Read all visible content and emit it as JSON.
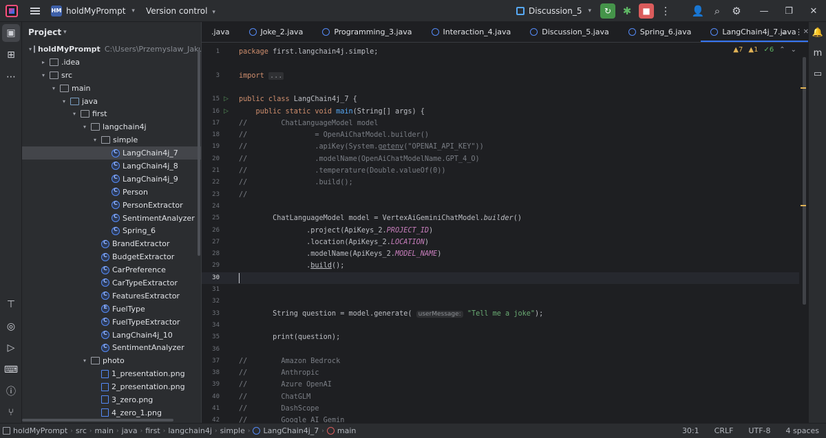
{
  "titlebar": {
    "project_badge": "HM",
    "project_name": "holdMyPrompt",
    "vcs_label": "Version control",
    "run_config": "Discussion_5"
  },
  "project_panel": {
    "title": "Project",
    "tree": [
      {
        "label": "holdMyPrompt",
        "hint": "C:\\Users\\Przemyslaw_Jakub",
        "depth": 0,
        "arrow": "down",
        "icon": "mod",
        "bold": true
      },
      {
        "label": ".idea",
        "depth": 1,
        "arrow": "right",
        "icon": "folder"
      },
      {
        "label": "src",
        "depth": 1,
        "arrow": "down",
        "icon": "folder"
      },
      {
        "label": "main",
        "depth": 2,
        "arrow": "down",
        "icon": "folder"
      },
      {
        "label": "java",
        "depth": 3,
        "arrow": "down",
        "icon": "folder src"
      },
      {
        "label": "first",
        "depth": 4,
        "arrow": "down",
        "icon": "folder"
      },
      {
        "label": "langchain4j",
        "depth": 5,
        "arrow": "down",
        "icon": "folder"
      },
      {
        "label": "simple",
        "depth": 6,
        "arrow": "down",
        "icon": "folder"
      },
      {
        "label": "LangChain4j_7",
        "depth": 7,
        "arrow": "",
        "icon": "cls",
        "selected": true
      },
      {
        "label": "LangChain4j_8",
        "depth": 7,
        "arrow": "",
        "icon": "cls"
      },
      {
        "label": "LangChain4j_9",
        "depth": 7,
        "arrow": "",
        "icon": "cls"
      },
      {
        "label": "Person",
        "depth": 7,
        "arrow": "",
        "icon": "cls"
      },
      {
        "label": "PersonExtractor",
        "depth": 7,
        "arrow": "",
        "icon": "cls"
      },
      {
        "label": "SentimentAnalyzer",
        "depth": 7,
        "arrow": "",
        "icon": "cls"
      },
      {
        "label": "Spring_6",
        "depth": 7,
        "arrow": "",
        "icon": "cls"
      },
      {
        "label": "BrandExtractor",
        "depth": 6,
        "arrow": "",
        "icon": "cls"
      },
      {
        "label": "BudgetExtractor",
        "depth": 6,
        "arrow": "",
        "icon": "cls"
      },
      {
        "label": "CarPreference",
        "depth": 6,
        "arrow": "",
        "icon": "cls"
      },
      {
        "label": "CarTypeExtractor",
        "depth": 6,
        "arrow": "",
        "icon": "cls"
      },
      {
        "label": "FeaturesExtractor",
        "depth": 6,
        "arrow": "",
        "icon": "cls"
      },
      {
        "label": "FuelType",
        "depth": 6,
        "arrow": "",
        "icon": "enm"
      },
      {
        "label": "FuelTypeExtractor",
        "depth": 6,
        "arrow": "",
        "icon": "cls"
      },
      {
        "label": "LangChain4j_10",
        "depth": 6,
        "arrow": "",
        "icon": "cls"
      },
      {
        "label": "SentimentAnalyzer",
        "depth": 6,
        "arrow": "",
        "icon": "cls"
      },
      {
        "label": "photo",
        "depth": 5,
        "arrow": "down",
        "icon": "folder"
      },
      {
        "label": "1_presentation.png",
        "depth": 6,
        "arrow": "",
        "icon": "img"
      },
      {
        "label": "2_presentation.png",
        "depth": 6,
        "arrow": "",
        "icon": "img"
      },
      {
        "label": "3_zero.png",
        "depth": 6,
        "arrow": "",
        "icon": "img"
      },
      {
        "label": "4_zero_1.png",
        "depth": 6,
        "arrow": "",
        "icon": "img"
      }
    ]
  },
  "tabs": [
    {
      "label": ".java",
      "active": false
    },
    {
      "label": "Joke_2.java",
      "active": false
    },
    {
      "label": "Programming_3.java",
      "active": false
    },
    {
      "label": "Interaction_4.java",
      "active": false
    },
    {
      "label": "Discussion_5.java",
      "active": false
    },
    {
      "label": "Spring_6.java",
      "active": false
    },
    {
      "label": "LangChain4j_7.java",
      "active": true
    }
  ],
  "inspections": {
    "warnings": "7",
    "weak_warnings": "1",
    "ok": "6"
  },
  "editor": {
    "current_line": "30",
    "lines": [
      {
        "n": "1",
        "html": "<span class=\"kw\">package</span> first.langchain4j.simple;"
      },
      {
        "n": "",
        "html": ""
      },
      {
        "n": "3",
        "html": "<span class=\"kw\">import</span> <span class=\"fold\">...</span>"
      },
      {
        "n": "",
        "html": ""
      },
      {
        "n": "15",
        "run": true,
        "html": "<span class=\"kw\">public class</span> LangChain4j_7 {"
      },
      {
        "n": "16",
        "run": true,
        "html": "    <span class=\"kw\">public static void</span> <span class=\"fn\">main</span>(String[] args) {"
      },
      {
        "n": "17",
        "html": "<span class=\"cm\">//        ChatLanguageModel model</span>"
      },
      {
        "n": "18",
        "html": "<span class=\"cm\">//                = OpenAiChatModel.builder()</span>"
      },
      {
        "n": "19",
        "html": "<span class=\"cm\">//                .apiKey(System.<span class=\"ul\">getenv</span>(\"OPENAI_API_KEY\"))</span>"
      },
      {
        "n": "20",
        "html": "<span class=\"cm\">//                .modelName(OpenAiChatModelName.GPT_4_O)</span>"
      },
      {
        "n": "21",
        "html": "<span class=\"cm\">//                .temperature(Double.valueOf(0))</span>"
      },
      {
        "n": "22",
        "html": "<span class=\"cm\">//                .build();</span>"
      },
      {
        "n": "23",
        "html": "<span class=\"cm\">//</span>"
      },
      {
        "n": "24",
        "html": ""
      },
      {
        "n": "25",
        "html": "        ChatLanguageModel model = VertexAiGeminiChatModel.<span class=\"it\">builder</span>()"
      },
      {
        "n": "26",
        "html": "                .project(ApiKeys_2.<span class=\"fld\">PROJECT_ID</span>)"
      },
      {
        "n": "27",
        "html": "                .location(ApiKeys_2.<span class=\"fld\">LOCATION</span>)"
      },
      {
        "n": "28",
        "html": "                .modelName(ApiKeys_2.<span class=\"fld\">MODEL_NAME</span>)"
      },
      {
        "n": "29",
        "html": "                .<span class=\"ul\">build</span>();"
      },
      {
        "n": "30",
        "html": "",
        "current": true
      },
      {
        "n": "31",
        "html": ""
      },
      {
        "n": "32",
        "html": ""
      },
      {
        "n": "33",
        "html": "        String question = model.generate( <span class=\"hint\">userMessage:</span> <span class=\"str\">\"Tell me a joke\"</span>);"
      },
      {
        "n": "34",
        "html": ""
      },
      {
        "n": "35",
        "html": "        print(question);"
      },
      {
        "n": "36",
        "html": ""
      },
      {
        "n": "37",
        "html": "<span class=\"cm\">//        Amazon Bedrock</span>"
      },
      {
        "n": "38",
        "html": "<span class=\"cm\">//        Anthropic</span>"
      },
      {
        "n": "39",
        "html": "<span class=\"cm\">//        Azure OpenAI</span>"
      },
      {
        "n": "40",
        "html": "<span class=\"cm\">//        ChatGLM</span>"
      },
      {
        "n": "41",
        "html": "<span class=\"cm\">//        DashScope</span>"
      },
      {
        "n": "42",
        "html": "<span class=\"cm\">//        Google AI <span class=\"ul\">Gemin</span></span>"
      }
    ]
  },
  "statusbar": {
    "crumbs": [
      "holdMyPrompt",
      "src",
      "main",
      "java",
      "first",
      "langchain4j",
      "simple",
      "LangChain4j_7",
      "main"
    ],
    "position": "30:1",
    "line_sep": "CRLF",
    "encoding": "UTF-8",
    "indent": "4 spaces"
  },
  "colors": {
    "accent": "#3574f0",
    "run_green": "#45944a",
    "stop_red": "#db5c5c"
  }
}
